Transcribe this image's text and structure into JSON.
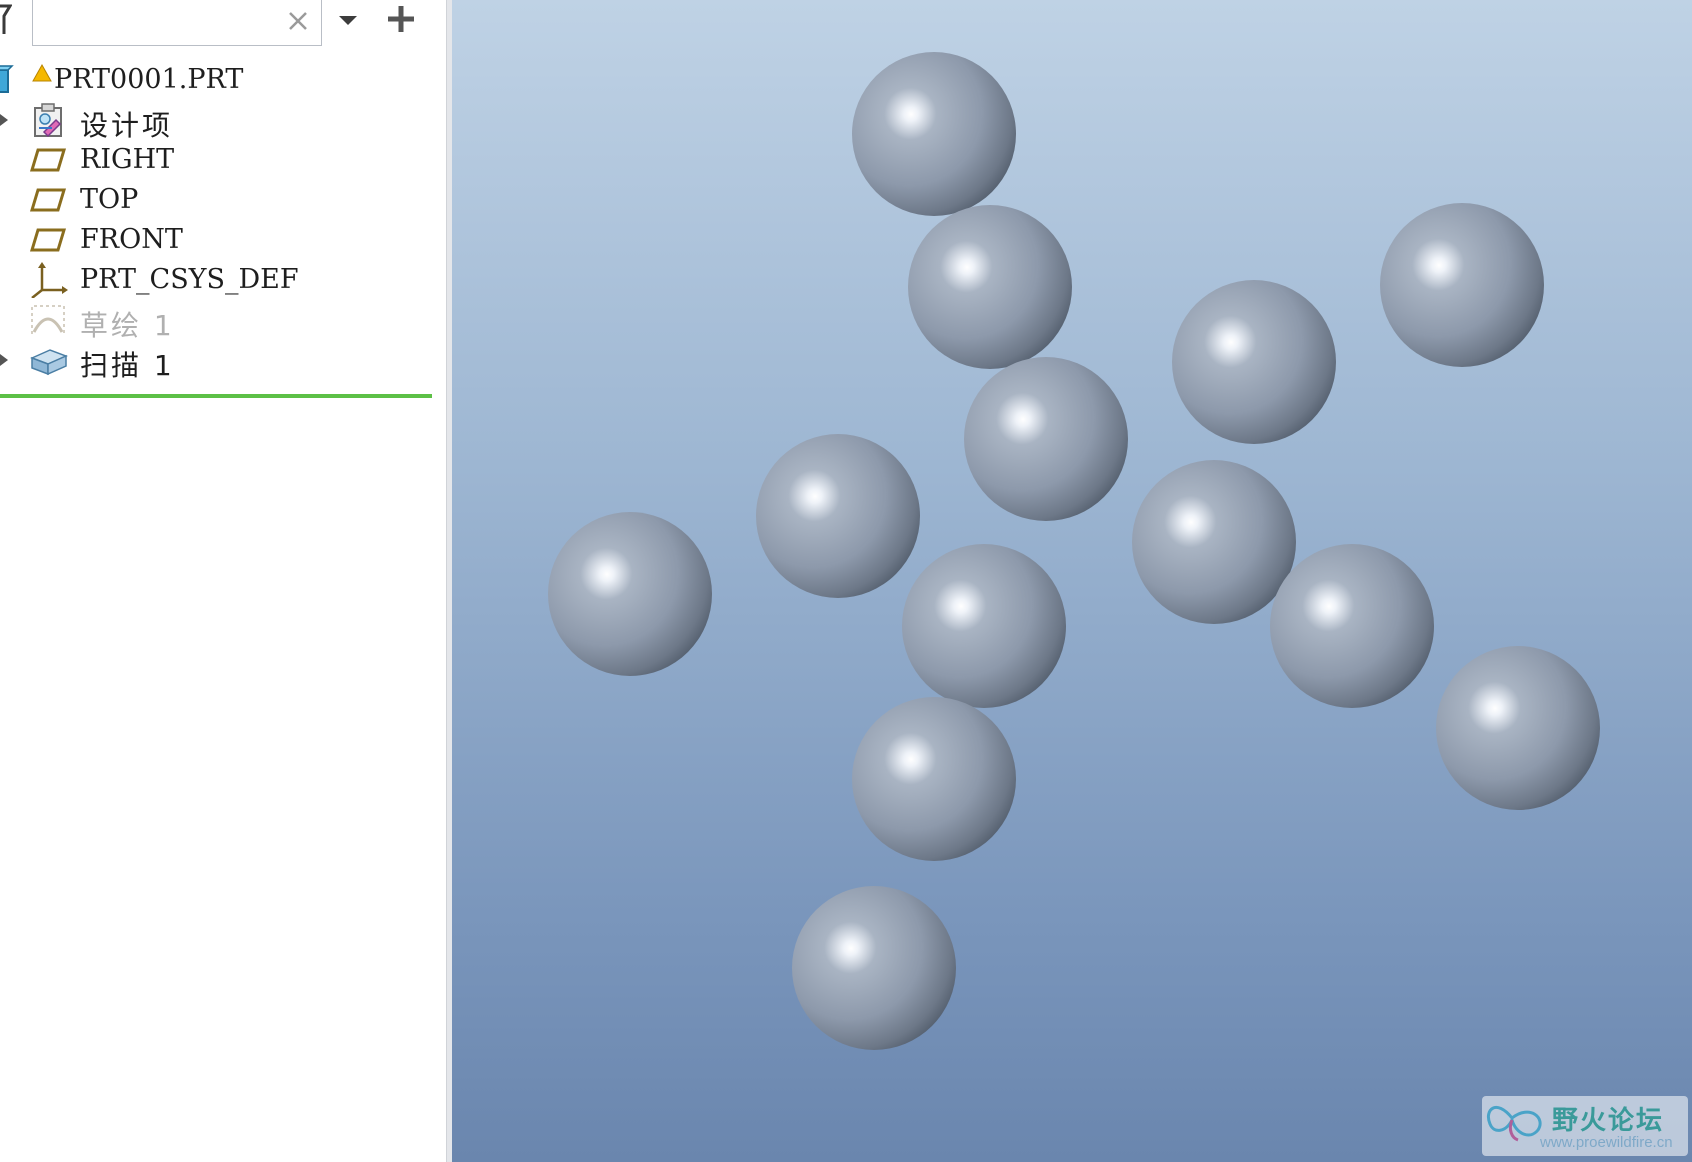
{
  "search": {
    "value": "",
    "placeholder": ""
  },
  "tree": {
    "root": {
      "label": "PRT0001.PRT",
      "icon": "part-icon",
      "warning_icon": "warning-triangle-icon"
    },
    "items": [
      {
        "label": "设计项",
        "icon": "design-items-icon",
        "expandable": true,
        "dimmed": false
      },
      {
        "label": "RIGHT",
        "icon": "datum-plane-icon",
        "expandable": false,
        "dimmed": false
      },
      {
        "label": "TOP",
        "icon": "datum-plane-icon",
        "expandable": false,
        "dimmed": false
      },
      {
        "label": "FRONT",
        "icon": "datum-plane-icon",
        "expandable": false,
        "dimmed": false
      },
      {
        "label": "PRT_CSYS_DEF",
        "icon": "coordinate-system-icon",
        "expandable": false,
        "dimmed": false
      },
      {
        "label": "草绘 1",
        "icon": "sketch-icon",
        "expandable": false,
        "dimmed": true
      },
      {
        "label": "扫描 1",
        "icon": "sweep-icon",
        "expandable": true,
        "dimmed": false
      }
    ],
    "insert_marker_color": "#5cc046"
  },
  "viewport": {
    "background_top": "#bfd2e5",
    "background_bottom": "#6a86ae",
    "sphere_color": "#8f9cae",
    "sphere_count": 13
  },
  "watermark": {
    "title": "野火论坛",
    "url": "www.proewildfire.cn"
  }
}
